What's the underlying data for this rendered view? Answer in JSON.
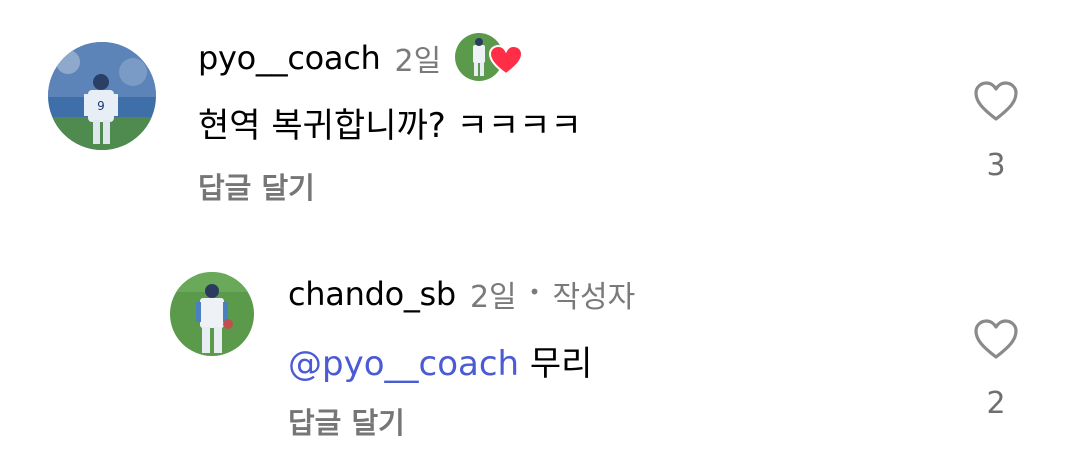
{
  "comments": [
    {
      "username": "pyo__coach",
      "time": "2일",
      "text": "현역 복귀합니까? ㅋㅋㅋㅋ",
      "reply_label": "답글 달기",
      "like_count": "3",
      "liked_by_author": true
    },
    {
      "username": "chando_sb",
      "time": "2일",
      "separator": "•",
      "author_tag": "작성자",
      "mention": "@pyo__coach",
      "text": "무리",
      "reply_label": "답글 달기",
      "like_count": "2"
    }
  ],
  "icons": {
    "like": "heart-outline-icon",
    "mention": "threads-at-icon",
    "creator_liked": "red-heart-icon"
  },
  "colors": {
    "mention": "#4a5bd4",
    "secondary_text": "#767676",
    "heart_red": "#ff2d46"
  }
}
